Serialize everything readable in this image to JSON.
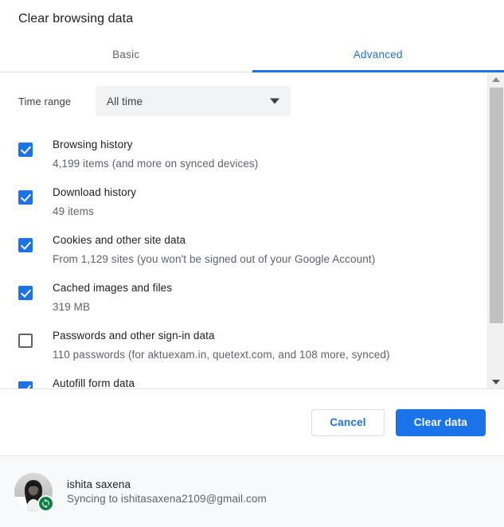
{
  "dialog": {
    "title": "Clear browsing data"
  },
  "tabs": [
    {
      "label": "Basic",
      "active": false
    },
    {
      "label": "Advanced",
      "active": true
    }
  ],
  "time_range": {
    "label": "Time range",
    "selected": "All time",
    "arrow_icon": "chevron-down-icon"
  },
  "items": [
    {
      "title": "Browsing history",
      "subtitle": "4,199 items (and more on synced devices)",
      "checked": true
    },
    {
      "title": "Download history",
      "subtitle": "49 items",
      "checked": true
    },
    {
      "title": "Cookies and other site data",
      "subtitle": "From 1,129 sites (you won't be signed out of your Google Account)",
      "checked": true
    },
    {
      "title": "Cached images and files",
      "subtitle": "319 MB",
      "checked": true
    },
    {
      "title": "Passwords and other sign-in data",
      "subtitle": "110 passwords (for aktuexam.in, quetext.com, and 108 more, synced)",
      "checked": false
    },
    {
      "title": "Autofill form data",
      "subtitle": "",
      "checked": true
    }
  ],
  "scrollbar": {
    "up_icon": "scroll-up-arrow-icon",
    "down_icon": "scroll-down-arrow-icon"
  },
  "actions": {
    "cancel_label": "Cancel",
    "confirm_label": "Clear data"
  },
  "account": {
    "avatar_icon": "user-avatar-photo",
    "sync_badge_icon": "sync-refresh-icon",
    "name": "ishita saxena",
    "status": "Syncing to ishitasaxena2109@gmail.com"
  },
  "colors": {
    "accent": "#1a73e8",
    "sync_green": "#0b8043",
    "text_primary": "#202124",
    "text_secondary": "#5f6368",
    "field_bg": "#f1f3f4",
    "footer_bg": "#f8f9fa"
  }
}
